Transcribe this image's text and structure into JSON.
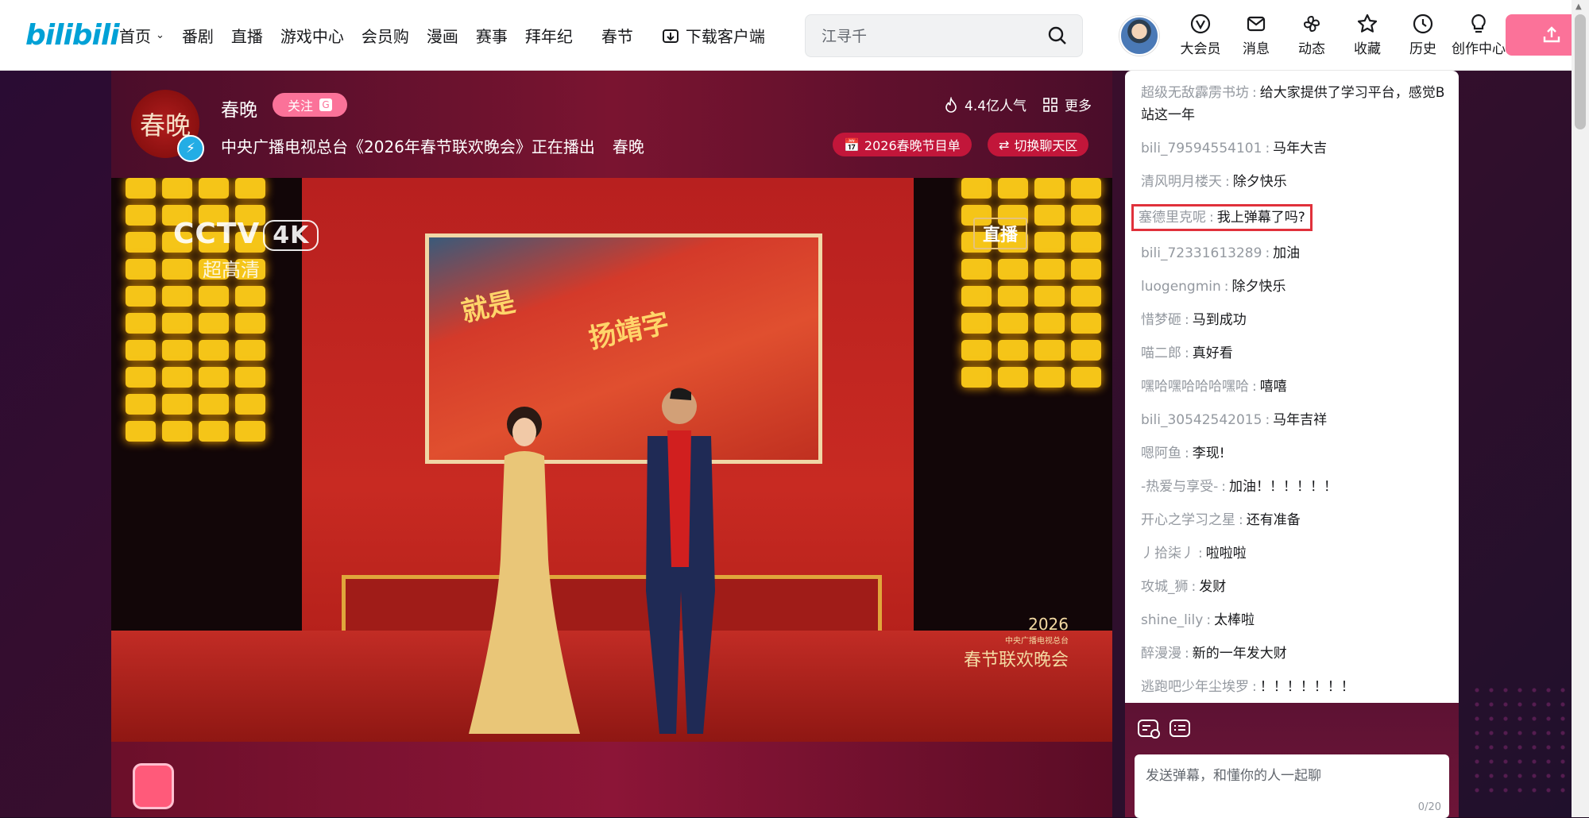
{
  "nav": {
    "logo": "bilibili",
    "items": [
      "首页",
      "番剧",
      "直播",
      "游戏中心",
      "会员购",
      "漫画",
      "赛事",
      "拜年纪",
      "春节"
    ],
    "download": "下载客户端"
  },
  "search": {
    "placeholder": "江寻千"
  },
  "user_menu": [
    "大会员",
    "消息",
    "动态",
    "收藏",
    "历史",
    "创作中心"
  ],
  "room": {
    "host_avatar_text": "春晚",
    "host_name": "春晚",
    "follow_label": "关注",
    "follow_badge": "G",
    "title": "中央广播电视总台《2026年春节联欢晚会》正在播出",
    "area": "春晚",
    "popularity": "4.4亿人气",
    "more": "更多",
    "program_btn": "2026春晚节目单",
    "switch_btn": "切换聊天区"
  },
  "video_overlay": {
    "channel": "CCTV",
    "channel_4k": "4K",
    "channel_sub": "超高清",
    "live": "直播",
    "gala_year": "2026",
    "gala_org": "中央广播电视总台",
    "gala_name": "春节联欢晚会",
    "flag_text_1": "扬靖字",
    "flag_text_2": "就是"
  },
  "chat": {
    "messages": [
      {
        "user": "超级无敌霹雳书坊",
        "text": "给大家提供了学习平台，感觉B站这一年"
      },
      {
        "user": "bili_79594554101",
        "text": "马年大吉"
      },
      {
        "user": "清风明月楼天",
        "text": "除夕快乐"
      },
      {
        "user": "塞德里克呢",
        "text": "我上弹幕了吗?"
      },
      {
        "user": "bili_72331613289",
        "text": "加油"
      },
      {
        "user": "luogengmin",
        "text": "除夕快乐"
      },
      {
        "user": "惜梦砸",
        "text": "马到成功"
      },
      {
        "user": "喵二郎",
        "text": "真好看"
      },
      {
        "user": "嘿哈嘿哈哈哈嘿哈",
        "text": "嘻嘻"
      },
      {
        "user": "bili_30542542015",
        "text": "马年吉祥"
      },
      {
        "user": "嗯阿鱼",
        "text": "李现!"
      },
      {
        "user": "-热爱与享受-",
        "text": "加油！！！！！！"
      },
      {
        "user": "开心之学习之星",
        "text": "还有准备"
      },
      {
        "user": "丿拾柒丿",
        "text": "啦啦啦"
      },
      {
        "user": "攻城_狮",
        "text": "发财"
      },
      {
        "user": "shine_lily",
        "text": "太棒啦"
      },
      {
        "user": "醉漫漫",
        "text": "新的一年发大财"
      },
      {
        "user": "逃跑吧少年尘埃罗",
        "text": "！！！！！！！"
      }
    ],
    "highlight_index": 3,
    "input_placeholder": "发送弹幕，和懂你的人一起聊",
    "counter": "0/20"
  },
  "colors": {
    "brand_blue": "#00a1d6",
    "brand_pink": "#fb7299",
    "highlight_red": "#e0313b"
  }
}
